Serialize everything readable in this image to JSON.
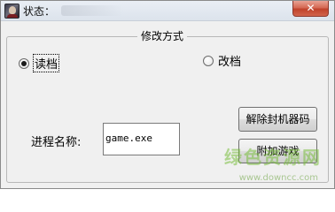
{
  "window": {
    "title": "状态：",
    "close_label": "✕"
  },
  "group": {
    "legend": "修改方式",
    "options": [
      {
        "label": "读档",
        "checked": true
      },
      {
        "label": "改档",
        "checked": false
      }
    ]
  },
  "process": {
    "label": "进程名称:",
    "value": "game.exe"
  },
  "buttons": {
    "unseal": "解除封机器码",
    "attach": "附加游戏"
  },
  "watermark": {
    "text": "绿色资源网",
    "url": "www.downcc.com"
  }
}
